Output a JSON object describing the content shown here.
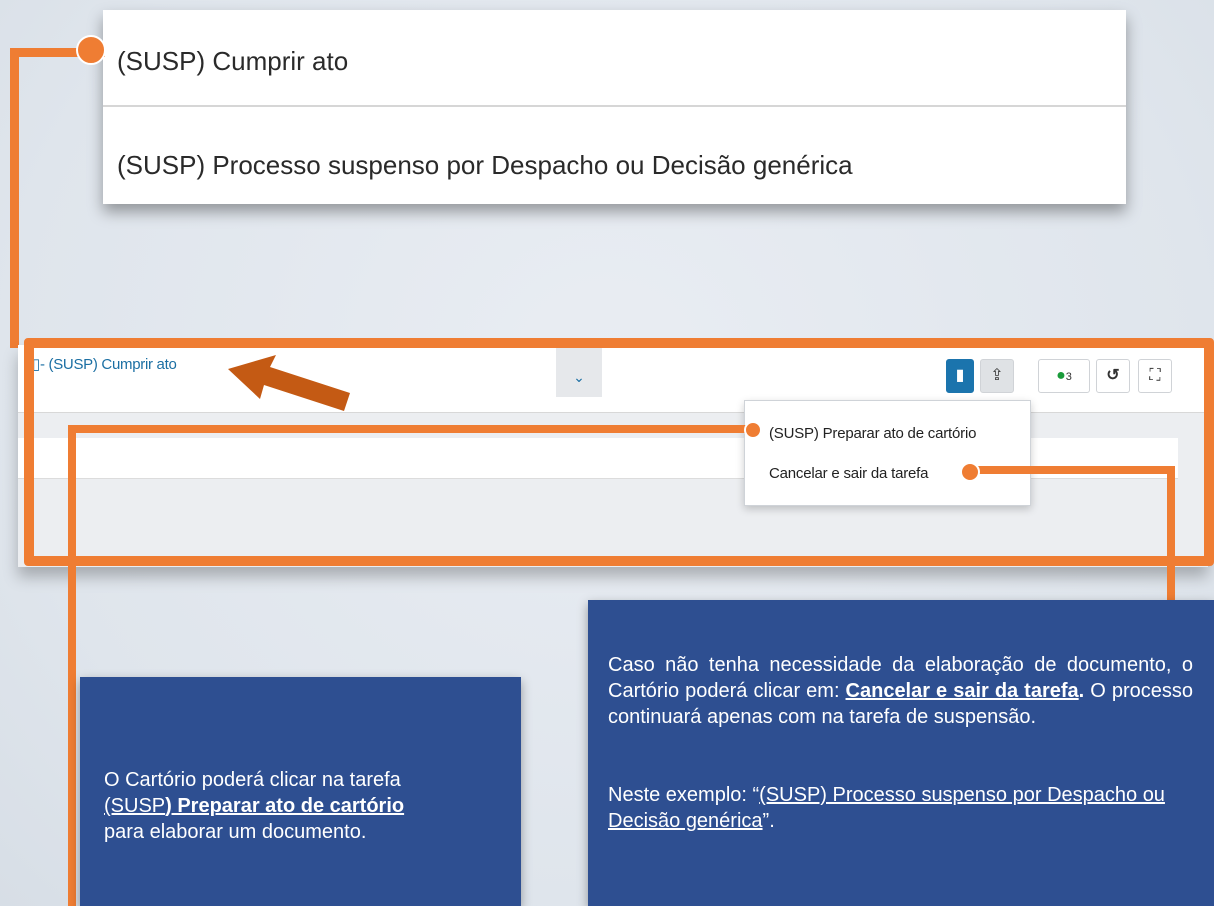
{
  "task_list": {
    "items": [
      "(SUSP) Cumprir ato",
      "(SUSP) Processo suspenso por Despacho ou Decisão genérica"
    ]
  },
  "app": {
    "task_title": "- (SUSP) Cumprir ato",
    "tag_count": "3",
    "dropdown": {
      "items": [
        "(SUSP) Preparar ato de cartório",
        "Cancelar e sair da tarefa"
      ]
    }
  },
  "info_left": {
    "line1": "O Cartório poderá clicar na tarefa",
    "task_prefix": "(SUSP",
    "task_bold": ") Preparar ato de cartório",
    "line3": "para elaborar um documento."
  },
  "info_right": {
    "p1_text": "Caso não tenha necessidade da elaboração de documento, o Cartório poderá clicar em:",
    "p1_link": "Cancelar e sair da tarefa",
    "p1_dot": ".",
    "p1_rest": " O processo continuará apenas com na tarefa de suspensão.",
    "p2_prefix": " Neste exemplo: “",
    "p2_link": "(SUSP) Processo suspenso por Despacho ou Decisão genérica",
    "p2_suffix": "”."
  },
  "colors": {
    "accent_orange": "#ef7d33",
    "box_blue": "#2e4f91",
    "primary_blue": "#1b74ad"
  }
}
